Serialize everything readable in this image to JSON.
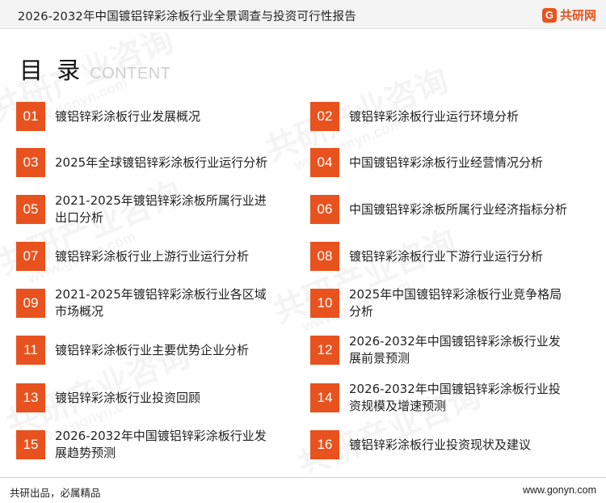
{
  "header": {
    "title": "2026-2032年中国镀铝锌彩涂板行业全景调查与投资可行性报告",
    "logo_text": "共研网",
    "logo_mark": "G"
  },
  "watermark": {
    "cn": "共研产业咨询",
    "url": "www.gonyn.com"
  },
  "toc": {
    "title": "目 录",
    "subtitle": "CONTENT",
    "items": [
      {
        "num": "01",
        "label": "镀铝锌彩涂板行业发展概况"
      },
      {
        "num": "02",
        "label": "镀铝锌彩涂板行业运行环境分析"
      },
      {
        "num": "03",
        "label": "2025年全球镀铝锌彩涂板行业运行分析"
      },
      {
        "num": "04",
        "label": "中国镀铝锌彩涂板行业经营情况分析"
      },
      {
        "num": "05",
        "label": "2021-2025年镀铝锌彩涂板所属行业进出口分析"
      },
      {
        "num": "06",
        "label": "中国镀铝锌彩涂板所属行业经济指标分析"
      },
      {
        "num": "07",
        "label": "镀铝锌彩涂板行业上游行业运行分析"
      },
      {
        "num": "08",
        "label": "镀铝锌彩涂板行业下游行业运行分析"
      },
      {
        "num": "09",
        "label": "2021-2025年镀铝锌彩涂板行业各区域市场概况"
      },
      {
        "num": "10",
        "label": "2025年中国镀铝锌彩涂板行业竞争格局分析"
      },
      {
        "num": "11",
        "label": "镀铝锌彩涂板行业主要优势企业分析"
      },
      {
        "num": "12",
        "label": "2026-2032年中国镀铝锌彩涂板行业发展前景预测"
      },
      {
        "num": "13",
        "label": "镀铝锌彩涂板行业投资回顾"
      },
      {
        "num": "14",
        "label": "2026-2032年中国镀铝锌彩涂板行业投资规模及增速预测"
      },
      {
        "num": "15",
        "label": "2026-2032年中国镀铝锌彩涂板行业发展趋势预测"
      },
      {
        "num": "16",
        "label": "镀铝锌彩涂板行业投资现状及建议"
      }
    ]
  },
  "footer": {
    "left": "共研出品，必属精品",
    "right": "www.gonyn.com"
  },
  "colors": {
    "accent": "#e8521e"
  }
}
